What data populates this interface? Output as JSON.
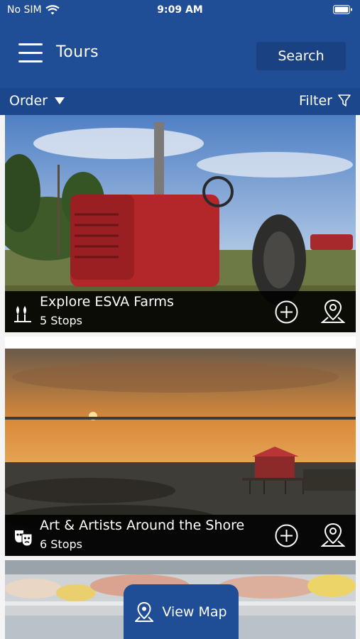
{
  "status_bar": {
    "carrier": "No SIM",
    "time": "9:09 AM"
  },
  "header": {
    "title": "Tours",
    "search_label": "Search"
  },
  "toolbar": {
    "order_label": "Order",
    "filter_label": "Filter"
  },
  "tours": [
    {
      "name": "Explore ESVA Farms",
      "stops": "5 Stops",
      "category_icon": "farm-icon",
      "photo": "red vintage tractor in field"
    },
    {
      "name": "Art & Artists Around the Shore",
      "stops": "6 Stops",
      "category_icon": "theater-masks-icon",
      "photo": "sunset over water with red shed"
    },
    {
      "name": "",
      "stops": "",
      "category_icon": "",
      "photo": "seafood display case"
    }
  ],
  "footer": {
    "view_map_label": "View Map"
  },
  "colors": {
    "header": "#1f4d96",
    "subbar": "#1d478d",
    "search_bg": "#1a4182",
    "caption_bg": "#000000"
  }
}
